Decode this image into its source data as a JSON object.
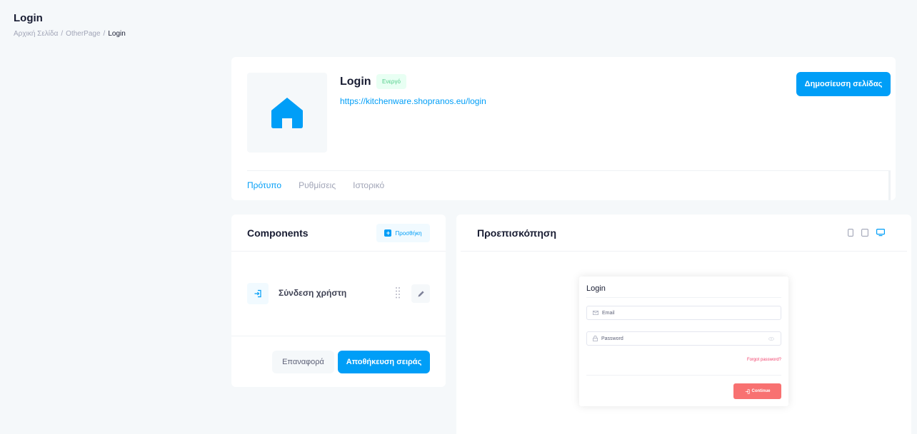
{
  "page": {
    "title": "Login"
  },
  "breadcrumb": {
    "home": "Αρχική Σελίδα",
    "sep": "/",
    "parent": "OtherPage",
    "current": "Login"
  },
  "header": {
    "title": "Login",
    "status": "Ενεργό",
    "url": "https://kitchenware.shopranos.eu/login",
    "publish_label": "Δημοσίευση σελίδας",
    "thumbnail_icon": "home-icon",
    "tabs": [
      {
        "label": "Πρότυπο",
        "active": true
      },
      {
        "label": "Ρυθμίσεις",
        "active": false
      },
      {
        "label": "Ιστορικό",
        "active": false
      }
    ]
  },
  "components": {
    "title": "Components",
    "add_label": "Προσθήκη",
    "items": [
      {
        "label": "Σύνδεση χρήστη",
        "icon": "sign-in-icon"
      }
    ],
    "reset_label": "Επαναφορά",
    "save_label": "Αποθήκευση σειράς"
  },
  "preview": {
    "title": "Προεπισκόπηση",
    "devices": [
      "mobile-icon",
      "tablet-icon",
      "desktop-icon"
    ],
    "selected_device": "desktop",
    "login_form": {
      "title": "Login",
      "email_placeholder": "Email",
      "password_placeholder": "Password",
      "forgot_label": "Forgot password?",
      "continue_label": "Continue"
    }
  },
  "colors": {
    "primary": "#009ef7",
    "success_text": "#50cd89",
    "danger": "#f1416c",
    "continue_bg": "#f87171"
  }
}
